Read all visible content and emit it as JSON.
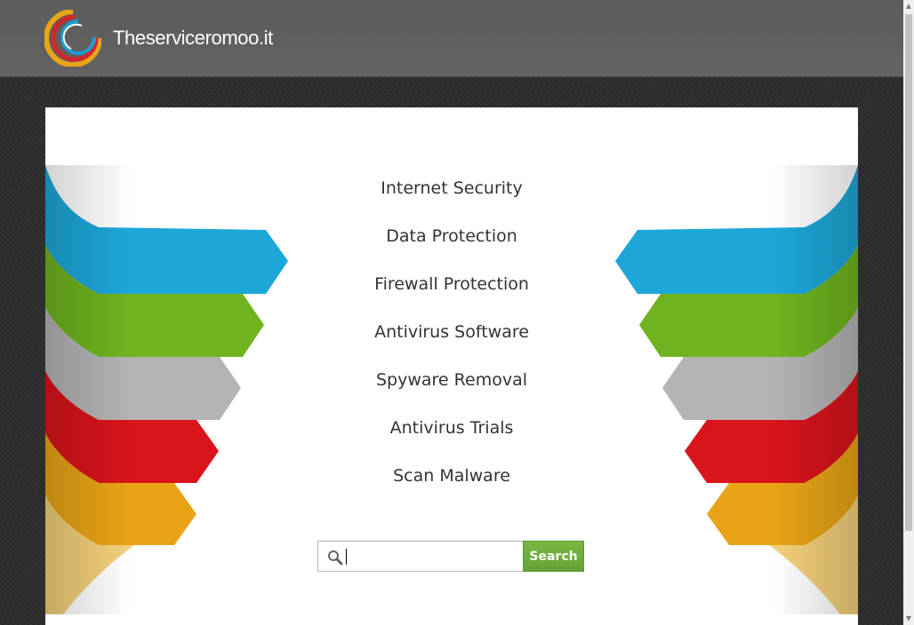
{
  "header": {
    "site_name": "Theserviceromoo.it",
    "logo_icon": "concentric-arcs-logo"
  },
  "links": [
    {
      "label": "Internet Security"
    },
    {
      "label": "Data Protection"
    },
    {
      "label": "Firewall Protection"
    },
    {
      "label": "Antivirus Software"
    },
    {
      "label": "Spyware Removal"
    },
    {
      "label": "Antivirus Trials"
    },
    {
      "label": "Scan Malware"
    }
  ],
  "search": {
    "value": "",
    "placeholder": "",
    "button_label": "Search",
    "icon": "search-icon"
  },
  "colors": {
    "header_bg": "#5f5f5f",
    "ribbon_blue": "#1da7d8",
    "ribbon_green": "#6fb41f",
    "ribbon_gray": "#b4b4b4",
    "ribbon_red": "#d9141b",
    "ribbon_orange": "#e8a416",
    "button_green": "#6aab3a"
  }
}
